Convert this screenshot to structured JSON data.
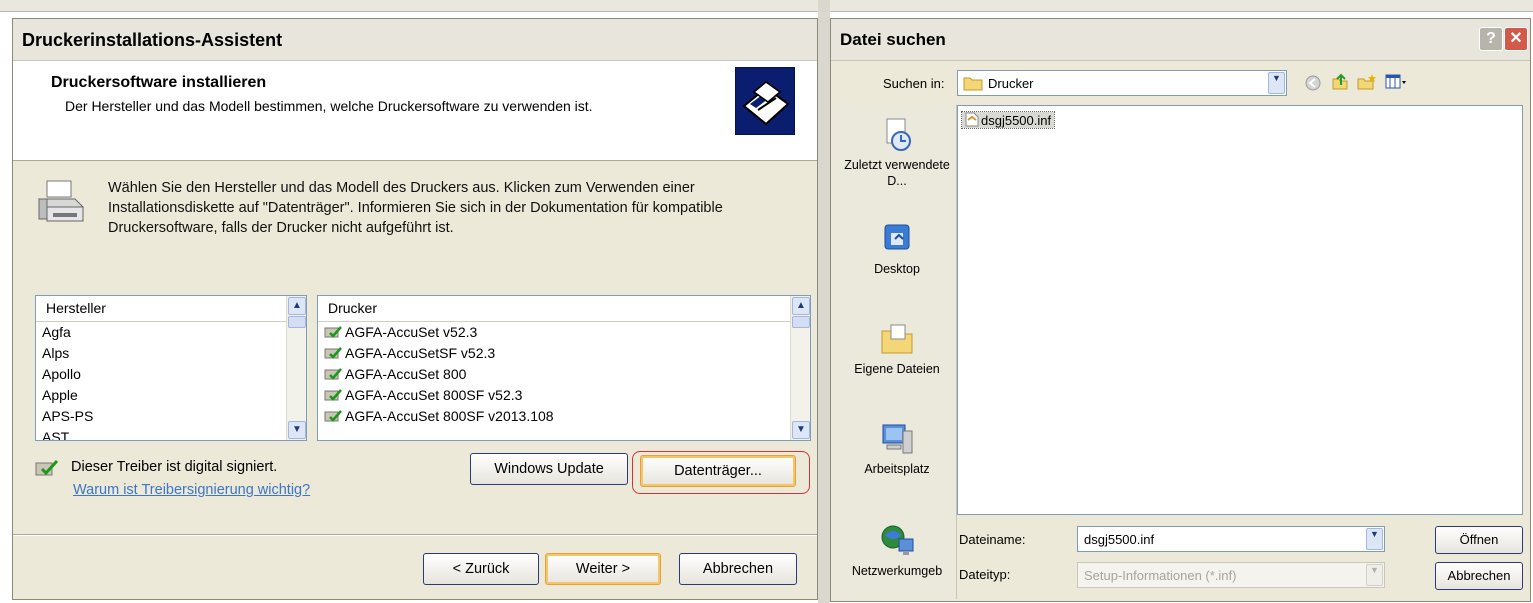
{
  "wizard": {
    "title": "Druckerinstallations-Assistent",
    "header_title": "Druckersoftware installieren",
    "header_subtitle": "Der Hersteller und das Modell bestimmen, welche Druckersoftware zu verwenden ist.",
    "instructions": "Wählen Sie den Hersteller und das Modell des Druckers aus. Klicken zum Verwenden einer Installationsdiskette auf \"Datenträger\". Informieren Sie sich in der Dokumentation für kompatible Druckersoftware, falls der Drucker nicht aufgeführt ist.",
    "manufacturers": {
      "header": "Hersteller",
      "items": [
        "Agfa",
        "Alps",
        "Apollo",
        "Apple",
        "APS-PS",
        "AST"
      ],
      "selected": "Agfa"
    },
    "printers": {
      "header": "Drucker",
      "items": [
        "AGFA-AccuSet v52.3",
        "AGFA-AccuSetSF v52.3",
        "AGFA-AccuSet 800",
        "AGFA-AccuSet 800SF v52.3",
        "AGFA-AccuSet 800SF v2013.108"
      ]
    },
    "signed_text": "Dieser Treiber ist digital signiert.",
    "signing_link": "Warum ist Treibersignierung wichtig?",
    "windows_update_button": "Windows Update",
    "disk_button": "Datenträger...",
    "back_button": "< Zurück",
    "next_button": "Weiter >",
    "cancel_button": "Abbrechen"
  },
  "file_dialog": {
    "title": "Datei suchen",
    "help_symbol": "?",
    "close_symbol": "✕",
    "look_in_label": "Suchen in:",
    "look_in_value": "Drucker",
    "places": [
      "Zuletzt verwendete D...",
      "Desktop",
      "Eigene Dateien",
      "Arbeitsplatz",
      "Netzwerkumgeb"
    ],
    "files": [
      "dsgj5500.inf"
    ],
    "filename_label": "Dateiname:",
    "filename_value": "dsgj5500.inf",
    "filetype_label": "Dateityp:",
    "filetype_value": "Setup-Informationen (*.inf)",
    "open_button": "Öffnen",
    "cancel_button": "Abbrechen"
  },
  "colors": {
    "dialog_bg": "#ece9d8",
    "highlight_ring": "#d1333a",
    "link": "#3b76c8",
    "wizard_icon_bg": "#0b1d6e"
  }
}
